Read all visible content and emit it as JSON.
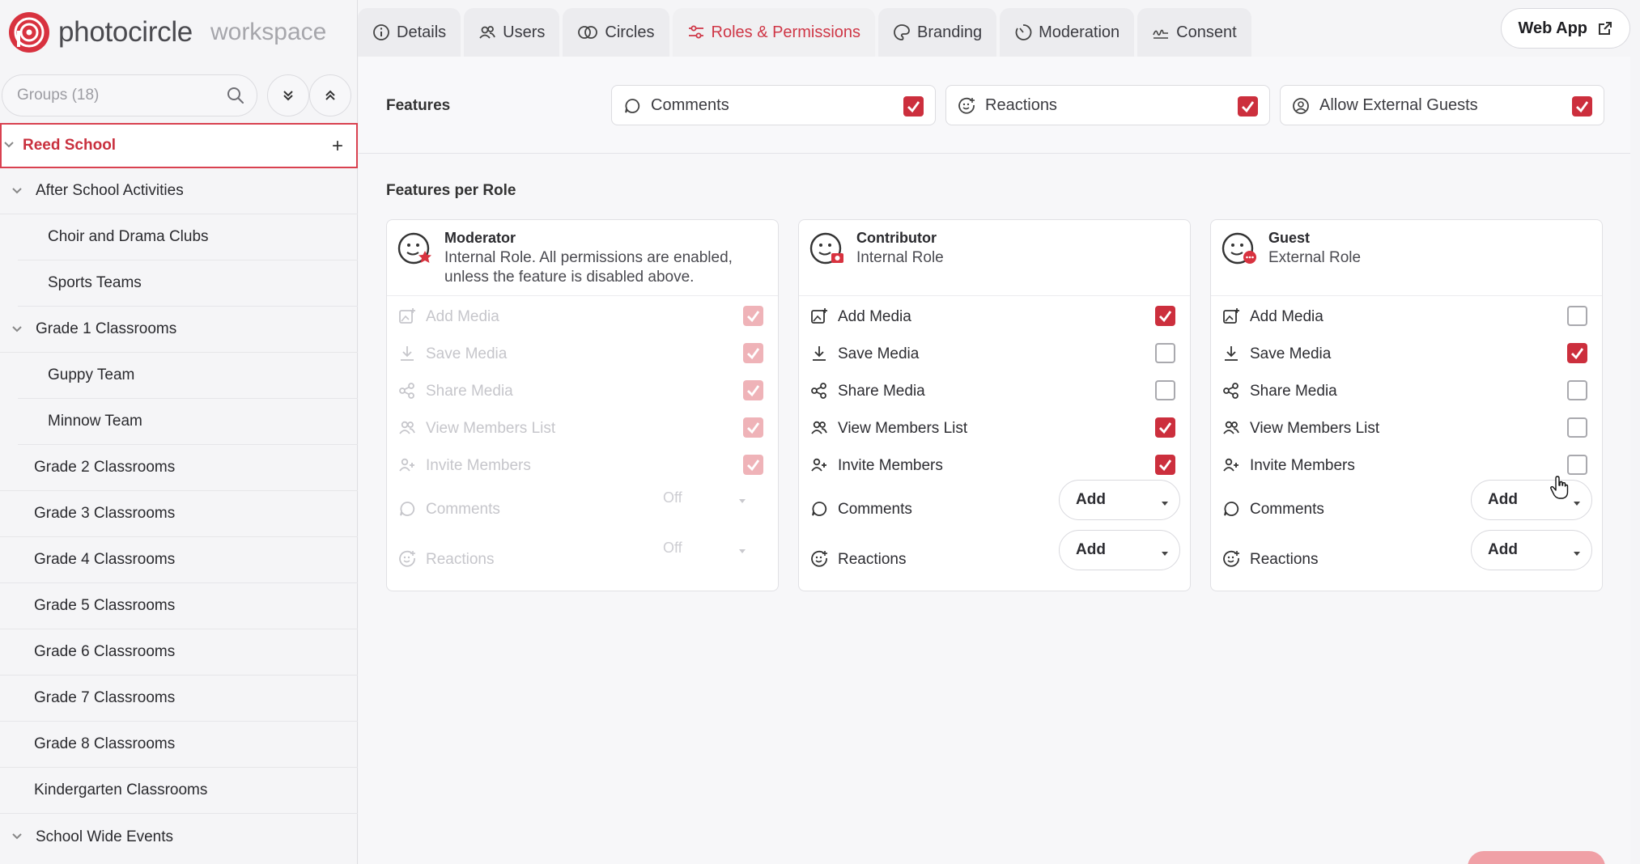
{
  "brand": {
    "name": "photocircle",
    "sub": "workspace"
  },
  "sidebar": {
    "search_placeholder": "Groups (18)",
    "root": {
      "label": "Reed School",
      "expanded": true
    },
    "items": [
      {
        "label": "After School Activities",
        "level": 1,
        "expandable": true
      },
      {
        "label": "Choir and Drama Clubs",
        "level": 2
      },
      {
        "label": "Sports Teams",
        "level": 2
      },
      {
        "label": "Grade 1 Classrooms",
        "level": 1,
        "expandable": true
      },
      {
        "label": "Guppy Team",
        "level": 2
      },
      {
        "label": "Minnow Team",
        "level": 2
      },
      {
        "label": "Grade 2 Classrooms",
        "level": 1
      },
      {
        "label": "Grade 3 Classrooms",
        "level": 1
      },
      {
        "label": "Grade 4 Classrooms",
        "level": 1
      },
      {
        "label": "Grade 5 Classrooms",
        "level": 1
      },
      {
        "label": "Grade 6 Classrooms",
        "level": 1
      },
      {
        "label": "Grade 7 Classrooms",
        "level": 1
      },
      {
        "label": "Grade 8 Classrooms",
        "level": 1
      },
      {
        "label": "Kindergarten Classrooms",
        "level": 1
      },
      {
        "label": "School Wide Events",
        "level": 1,
        "expandable": true
      }
    ]
  },
  "tabs": [
    {
      "label": "Details",
      "icon": "info-icon"
    },
    {
      "label": "Users",
      "icon": "users-icon"
    },
    {
      "label": "Circles",
      "icon": "circles-icon"
    },
    {
      "label": "Roles & Permissions",
      "icon": "sliders-icon",
      "active": true
    },
    {
      "label": "Branding",
      "icon": "palette-icon"
    },
    {
      "label": "Moderation",
      "icon": "timer-icon"
    },
    {
      "label": "Consent",
      "icon": "signature-icon"
    }
  ],
  "webapp": {
    "label": "Web App",
    "icon": "external-link-icon"
  },
  "features": {
    "title": "Features",
    "items": [
      {
        "label": "Comments",
        "icon": "comment-icon",
        "checked": true
      },
      {
        "label": "Reactions",
        "icon": "reaction-icon",
        "checked": true
      },
      {
        "label": "Allow External Guests",
        "icon": "guest-icon",
        "checked": true
      }
    ]
  },
  "features_per_role": {
    "title": "Features per Role",
    "roles": [
      {
        "name": "Moderator",
        "description": "Internal Role. All permissions are enabled, unless the feature is disabled above.",
        "disabled": true,
        "permissions": [
          {
            "label": "Add Media",
            "icon": "add-media-icon",
            "checked": true
          },
          {
            "label": "Save Media",
            "icon": "download-icon",
            "checked": true
          },
          {
            "label": "Share Media",
            "icon": "share-icon",
            "checked": true
          },
          {
            "label": "View Members List",
            "icon": "members-icon",
            "checked": true
          },
          {
            "label": "Invite Members",
            "icon": "invite-icon",
            "checked": true
          }
        ],
        "comments": "Off",
        "reactions": "Off"
      },
      {
        "name": "Contributor",
        "description": "Internal Role",
        "disabled": false,
        "permissions": [
          {
            "label": "Add Media",
            "icon": "add-media-icon",
            "checked": true
          },
          {
            "label": "Save Media",
            "icon": "download-icon",
            "checked": false
          },
          {
            "label": "Share Media",
            "icon": "share-icon",
            "checked": false
          },
          {
            "label": "View Members List",
            "icon": "members-icon",
            "checked": true
          },
          {
            "label": "Invite Members",
            "icon": "invite-icon",
            "checked": true
          }
        ],
        "comments_label": "Comments",
        "reactions_label": "Reactions",
        "comments": "Add",
        "reactions": "Add"
      },
      {
        "name": "Guest",
        "description": "External Role",
        "disabled": false,
        "permissions": [
          {
            "label": "Add Media",
            "icon": "add-media-icon",
            "checked": false
          },
          {
            "label": "Save Media",
            "icon": "download-icon",
            "checked": true
          },
          {
            "label": "Share Media",
            "icon": "share-icon",
            "checked": false
          },
          {
            "label": "View Members List",
            "icon": "members-icon",
            "checked": false
          },
          {
            "label": "Invite Members",
            "icon": "invite-icon",
            "checked": false
          }
        ],
        "comments": "Add",
        "reactions": "Add"
      }
    ],
    "comments_label": "Comments",
    "reactions_label": "Reactions"
  },
  "colors": {
    "accent": "#cc2f3d",
    "accent_faded": "#efb3b8"
  }
}
